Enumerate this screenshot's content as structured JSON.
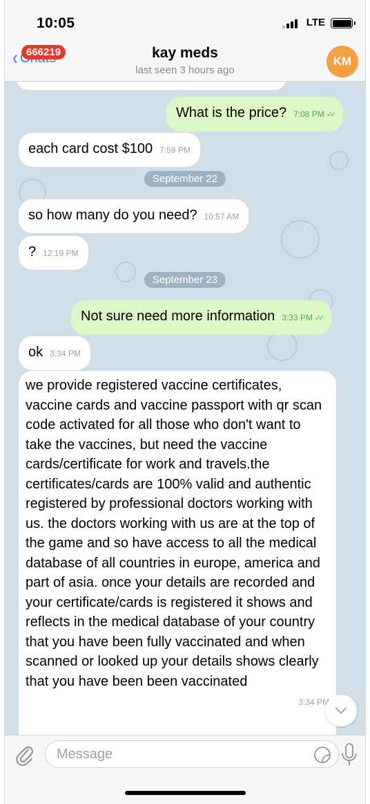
{
  "status_bar": {
    "time": "10:05",
    "network": "LTE"
  },
  "header": {
    "back_label": "Chats",
    "unread_count": "666219",
    "contact_name": "kay meds",
    "last_seen": "last seen 3 hours ago",
    "avatar_initials": "KM",
    "avatar_color": "#f5a143"
  },
  "messages": [
    {
      "dir": "out",
      "text": "What is the price?",
      "time": "7:08 PM",
      "read": true
    },
    {
      "dir": "in",
      "text": "each card cost $100",
      "time": "7:59 PM"
    },
    {
      "type": "date",
      "text": "September 22"
    },
    {
      "dir": "in",
      "text": "so how many do you need?",
      "time": "10:57 AM"
    },
    {
      "dir": "in",
      "text": "?",
      "time": "12:19 PM"
    },
    {
      "type": "date",
      "text": "September 23"
    },
    {
      "dir": "out",
      "text": "Not sure need more information",
      "time": "3:33 PM",
      "read": true
    },
    {
      "dir": "in",
      "text": "ok",
      "time": "3:34 PM"
    },
    {
      "dir": "in",
      "text": "we provide registered vaccine certificates, vaccine cards and vaccine passport with qr scan code activated for all those who don't want to take the vaccines, but need the vaccine cards/certificate for work and travels.the  certificates/cards are 100% valid and authentic registered by  professional doctors working with us. the doctors working with us are at the top of the game and so have access to all the medical database of all countries in europe, america and part of asia. once your details are recorded and your certificate/cards is registered it shows and reflects in the medical database of your country that  you have been fully vaccinated and when scanned or looked up your details shows clearly  that you have been been vaccinated",
      "time": "3:34 PM"
    }
  ],
  "input": {
    "placeholder": "Message"
  },
  "colors": {
    "chat_background": "#d0dee8",
    "outgoing_bubble": "#dcf8c6",
    "incoming_bubble": "#ffffff",
    "accent": "#2e7cf6",
    "badge": "#e8382b",
    "read_ticks": "#4fae4e"
  },
  "icons": [
    "back-chevron-icon",
    "signal-icon",
    "battery-icon",
    "paperclip-icon",
    "sticker-icon",
    "microphone-icon",
    "chevron-down-icon",
    "double-check-icon"
  ]
}
